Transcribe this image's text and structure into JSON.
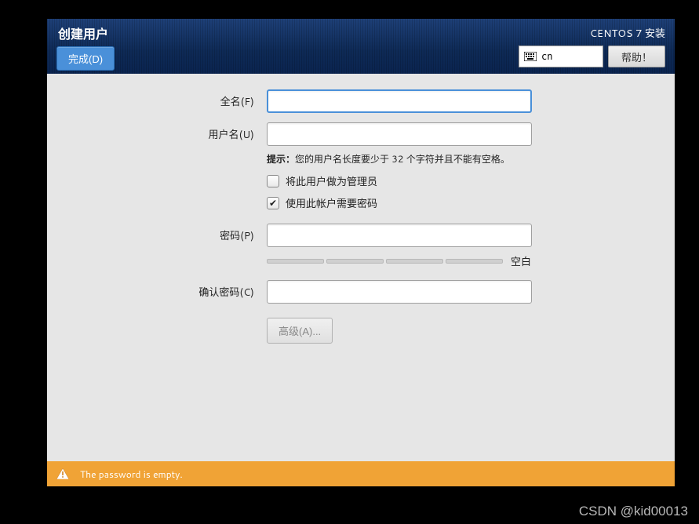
{
  "header": {
    "title": "创建用户",
    "done_label": "完成(D)",
    "distro_label": "CENTOS 7 安装",
    "keyboard_layout": "cn",
    "help_label": "帮助！"
  },
  "form": {
    "fullname_label": "全名(F)",
    "fullname_value": "",
    "username_label": "用户名(U)",
    "username_value": "",
    "hint_prefix": "提示：",
    "hint_text": "您的用户名长度要少于 32 个字符并且不能有空格。",
    "admin_checkbox_label": "将此用户做为管理员",
    "admin_checked": false,
    "require_password_label": "使用此帐户需要密码",
    "require_password_checked": true,
    "password_label": "密码(P)",
    "password_value": "",
    "password_strength_label": "空白",
    "confirm_password_label": "确认密码(C)",
    "confirm_password_value": "",
    "advanced_label": "高级(A)..."
  },
  "warning": {
    "message": "The password is empty."
  },
  "watermark": "CSDN @kid00013"
}
